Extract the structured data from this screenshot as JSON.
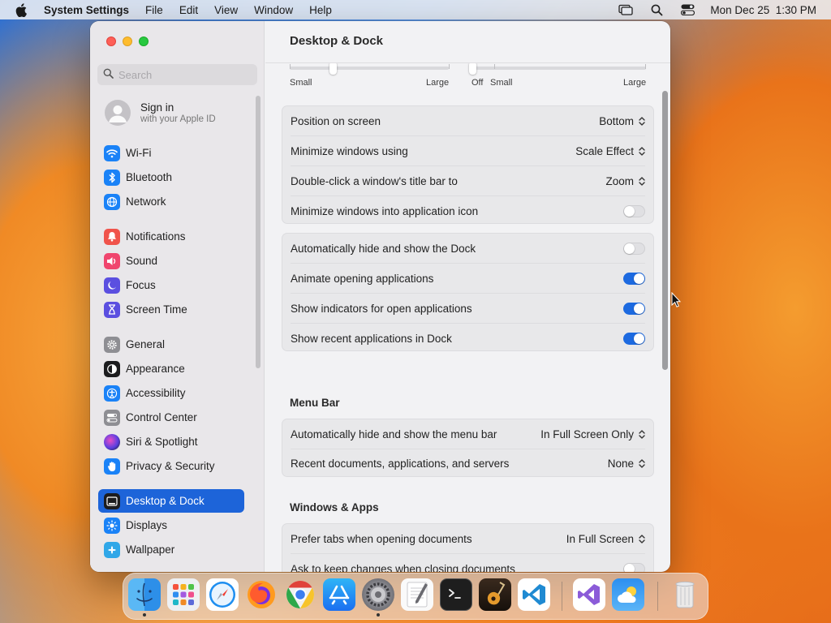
{
  "menubar": {
    "app_name": "System Settings",
    "items": [
      "File",
      "Edit",
      "View",
      "Window",
      "Help"
    ],
    "datetime": "Mon Dec 25  1:30 PM"
  },
  "sidebar": {
    "search_placeholder": "Search",
    "signin_title": "Sign in",
    "signin_subtitle": "with your Apple ID",
    "items": [
      {
        "label": "Wi-Fi",
        "icon": "wifi-icon",
        "color": "#1a82f7"
      },
      {
        "label": "Bluetooth",
        "icon": "bluetooth-icon",
        "color": "#1a82f7"
      },
      {
        "label": "Network",
        "icon": "globe-icon",
        "color": "#1a82f7"
      },
      {
        "label": "Notifications",
        "icon": "bell-icon",
        "color": "#f0534b"
      },
      {
        "label": "Sound",
        "icon": "speaker-icon",
        "color": "#f0456e"
      },
      {
        "label": "Focus",
        "icon": "moon-icon",
        "color": "#5b4fe0"
      },
      {
        "label": "Screen Time",
        "icon": "hourglass-icon",
        "color": "#5b4fe0"
      },
      {
        "label": "General",
        "icon": "gear-icon",
        "color": "#8e8e93"
      },
      {
        "label": "Appearance",
        "icon": "appearance-icon",
        "color": "#1c1c1e"
      },
      {
        "label": "Accessibility",
        "icon": "accessibility-icon",
        "color": "#1a82f7"
      },
      {
        "label": "Control Center",
        "icon": "control-center-icon",
        "color": "#8e8e93"
      },
      {
        "label": "Siri & Spotlight",
        "icon": "siri-icon",
        "color": "#9b3fd6"
      },
      {
        "label": "Privacy & Security",
        "icon": "hand-icon",
        "color": "#1a82f7"
      },
      {
        "label": "Desktop & Dock",
        "icon": "dock-icon",
        "color": "#1c1c1e"
      },
      {
        "label": "Displays",
        "icon": "sun-icon",
        "color": "#1a82f7"
      },
      {
        "label": "Wallpaper",
        "icon": "wallpaper-icon",
        "color": "#30a7e8"
      }
    ],
    "selected": "Desktop & Dock"
  },
  "main": {
    "title": "Desktop & Dock",
    "size_slider": {
      "min_label": "Small",
      "max_label": "Large",
      "value": 0.27
    },
    "magnification_slider": {
      "off_label": "Off",
      "min_label": "Small",
      "max_label": "Large",
      "value": 0.0
    },
    "dock_group": [
      {
        "label": "Position on screen",
        "control": "popup",
        "value": "Bottom"
      },
      {
        "label": "Minimize windows using",
        "control": "popup",
        "value": "Scale Effect"
      },
      {
        "label": "Double-click a window's title bar to",
        "control": "popup",
        "value": "Zoom"
      },
      {
        "label": "Minimize windows into application icon",
        "control": "toggle",
        "on": false
      }
    ],
    "behavior_group": [
      {
        "label": "Automatically hide and show the Dock",
        "control": "toggle",
        "on": false
      },
      {
        "label": "Animate opening applications",
        "control": "toggle",
        "on": true
      },
      {
        "label": "Show indicators for open applications",
        "control": "toggle",
        "on": true
      },
      {
        "label": "Show recent applications in Dock",
        "control": "toggle",
        "on": true
      }
    ],
    "menu_bar_heading": "Menu Bar",
    "menu_bar_group": [
      {
        "label": "Automatically hide and show the menu bar",
        "control": "popup",
        "value": "In Full Screen Only"
      },
      {
        "label": "Recent documents, applications, and servers",
        "control": "popup",
        "value": "None"
      }
    ],
    "windows_heading": "Windows & Apps",
    "windows_group": [
      {
        "label": "Prefer tabs when opening documents",
        "control": "popup",
        "value": "In Full Screen"
      },
      {
        "label": "Ask to keep changes when closing documents",
        "control": "toggle",
        "on": false
      }
    ]
  },
  "dock": {
    "apps": [
      {
        "name": "finder-icon",
        "running": true
      },
      {
        "name": "launchpad-icon",
        "running": false
      },
      {
        "name": "safari-icon",
        "running": false
      },
      {
        "name": "firefox-icon",
        "running": false
      },
      {
        "name": "chrome-icon",
        "running": false
      },
      {
        "name": "app-store-icon",
        "running": false
      },
      {
        "name": "system-settings-icon",
        "running": true
      },
      {
        "name": "textedit-icon",
        "running": false
      },
      {
        "name": "terminal-icon",
        "running": false
      },
      {
        "name": "garageband-icon",
        "running": false
      },
      {
        "name": "vscode-icon",
        "running": false
      },
      {
        "name": "visual-studio-icon",
        "running": false
      },
      {
        "name": "weather-icon",
        "running": false
      },
      {
        "name": "trash-icon",
        "running": false
      }
    ]
  }
}
